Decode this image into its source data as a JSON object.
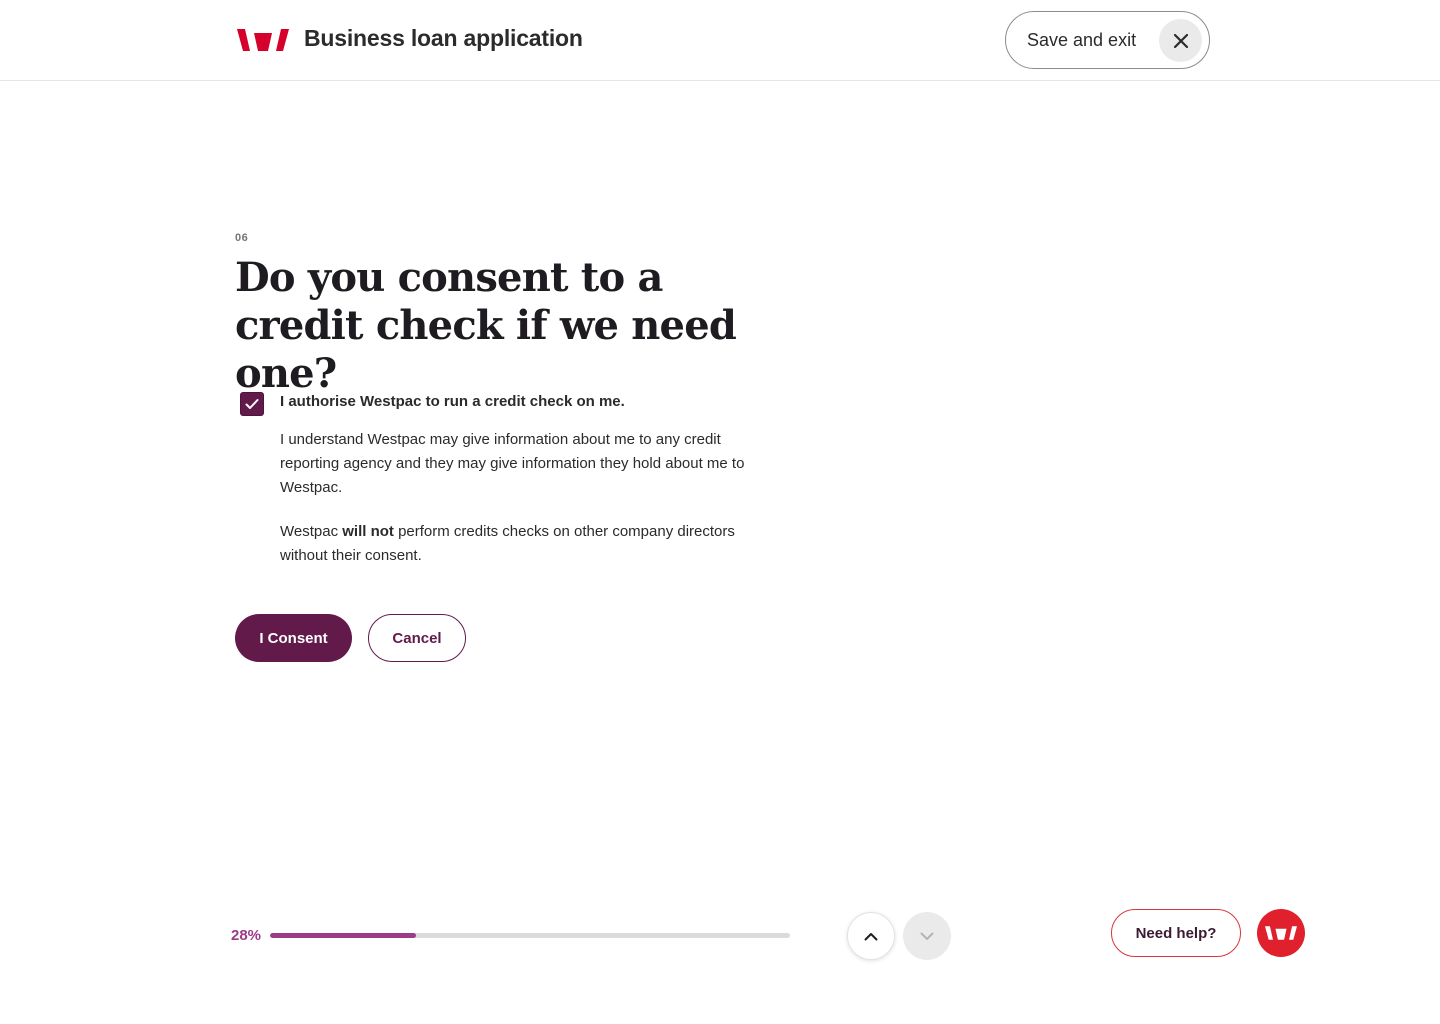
{
  "header": {
    "logo_icon": "westpac-logo-icon",
    "title": "Business loan application",
    "save_exit_label": "Save and exit",
    "close_icon": "close-icon",
    "brand_color": "#d5002b"
  },
  "question": {
    "step": "06",
    "title": "Do you consent to a credit check if we need one?"
  },
  "consent": {
    "checked": true,
    "checkbox_label": "I authorise Westpac to run a credit check on me.",
    "paragraph1": "I understand Westpac may give information about me to any credit reporting agency and they may give information they hold about me to Westpac.",
    "paragraph2_prefix": "Westpac ",
    "paragraph2_bold": "will not",
    "paragraph2_suffix": " perform credits checks on other company directors without their consent."
  },
  "actions": {
    "consent_label": "I Consent",
    "cancel_label": "Cancel",
    "primary_color": "#621a4b"
  },
  "progress": {
    "label": "28%",
    "value": 0.28,
    "color": "#9c3c85"
  },
  "nav": {
    "up_icon": "chevron-up-icon",
    "down_icon": "chevron-down-icon"
  },
  "help": {
    "label": "Need help?",
    "avatar_icon": "westpac-logo-icon"
  }
}
